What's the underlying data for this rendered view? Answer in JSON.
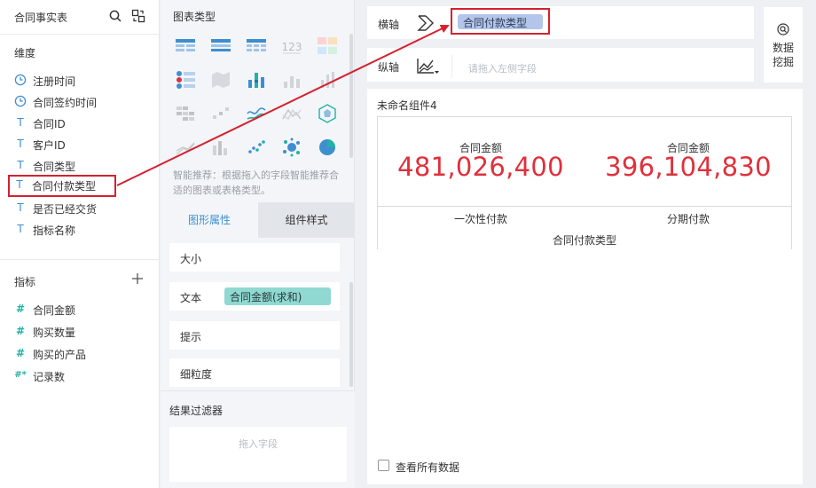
{
  "left_panel": {
    "table_name": "合同事实表",
    "dimension_title": "维度",
    "dimensions": [
      {
        "icon": "clock-icon",
        "label": "注册时间"
      },
      {
        "icon": "clock-icon",
        "label": "合同签约时间"
      },
      {
        "icon": "text-type-icon",
        "label": "合同ID"
      },
      {
        "icon": "text-type-icon",
        "label": "客户ID"
      },
      {
        "icon": "text-type-icon",
        "label": "合同类型"
      },
      {
        "icon": "text-type-icon",
        "label": "合同付款类型",
        "highlighted": true
      },
      {
        "icon": "text-type-icon",
        "label": "是否已经交货"
      },
      {
        "icon": "text-type-icon",
        "label": "指标名称"
      }
    ],
    "metric_title": "指标",
    "metrics": [
      {
        "icon": "hash-icon",
        "glyph": "#",
        "label": "合同金额"
      },
      {
        "icon": "hash-icon",
        "glyph": "#",
        "label": "购买数量"
      },
      {
        "icon": "hash-icon",
        "glyph": "#",
        "label": "购买的产品"
      },
      {
        "icon": "hash-star-icon",
        "glyph": "#*",
        "label": "记录数"
      }
    ]
  },
  "middle_panel": {
    "chart_type_title": "图表类型",
    "recommend_text": "智能推荐：根据拖入的字段智能推荐合适的图表或表格类型。",
    "tabs": [
      {
        "label": "图形属性",
        "active": true
      },
      {
        "label": "组件样式",
        "active": false
      }
    ],
    "properties": {
      "size": "大小",
      "text": "文本",
      "text_field": "合同金额(求和)",
      "tooltip": "提示",
      "granularity": "细粒度"
    },
    "result_filter": {
      "title": "结果过滤器",
      "placeholder": "拖入字段"
    }
  },
  "axes": {
    "x_label": "横轴",
    "x_field": "合同付款类型",
    "y_label": "纵轴",
    "y_placeholder": "请拖入左侧字段"
  },
  "data_mining": {
    "line1": "数据",
    "line2": "挖掘"
  },
  "widget": {
    "title": "未命名组件4",
    "kpis": [
      {
        "caption": "合同金额",
        "value": "481,026,400",
        "category": "一次性付款"
      },
      {
        "caption": "合同金额",
        "value": "396,104,830",
        "category": "分期付款"
      }
    ],
    "axis_title": "合同付款类型",
    "view_all": "查看所有数据",
    "view_all_checked": false
  },
  "colors": {
    "accent": "#3e8ed0",
    "highlight_border": "#d5212f",
    "kpi_value": "#e0303c",
    "x_pill": "#b3c6ea",
    "text_pill": "#8fd9d2"
  }
}
